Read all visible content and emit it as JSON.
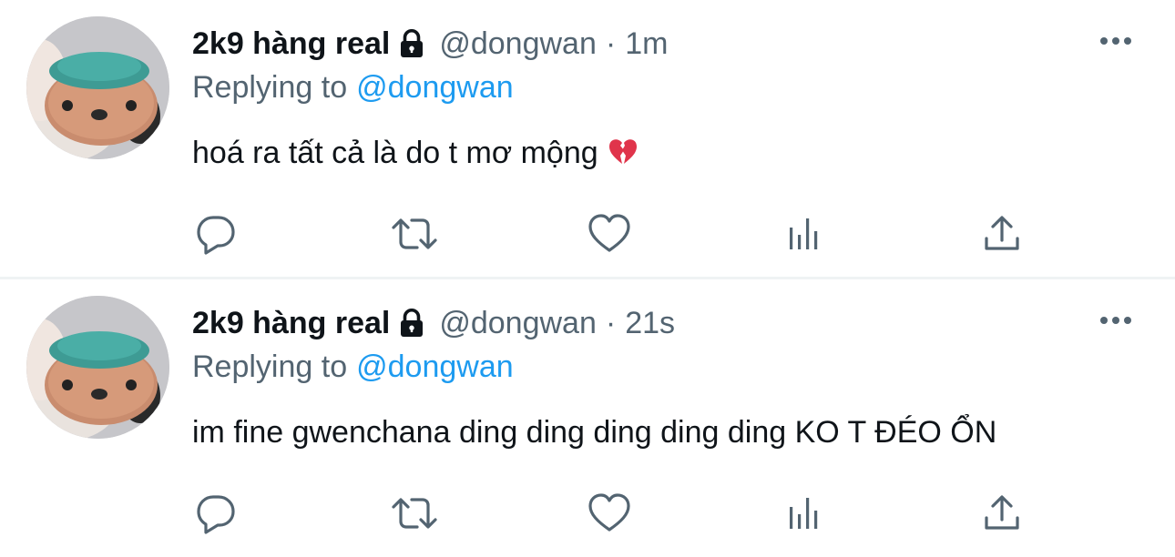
{
  "tweets": [
    {
      "display_name": "2k9 hàng real",
      "handle": "@dongwan",
      "separator": "·",
      "time": "1m",
      "replying_prefix": "Replying to",
      "replying_to": "@dongwan",
      "text": "hoá ra tất cả là do t mơ mộng",
      "text_emoji": "broken-heart-emoji"
    },
    {
      "display_name": "2k9 hàng real",
      "handle": "@dongwan",
      "separator": "·",
      "time": "21s",
      "replying_prefix": "Replying to",
      "replying_to": "@dongwan",
      "text": "im fine gwenchana ding ding ding ding ding KO T ĐÉO ỔN"
    }
  ],
  "icons": {
    "verified_lock": "lock-icon",
    "more": "more-horizontal-icon",
    "reply": "reply-icon",
    "retweet": "retweet-icon",
    "like": "heart-icon",
    "views": "analytics-icon",
    "share": "share-icon"
  },
  "colors": {
    "text_primary": "#0f1419",
    "text_secondary": "#536471",
    "link": "#1d9bf0",
    "divider": "#eff3f4"
  }
}
